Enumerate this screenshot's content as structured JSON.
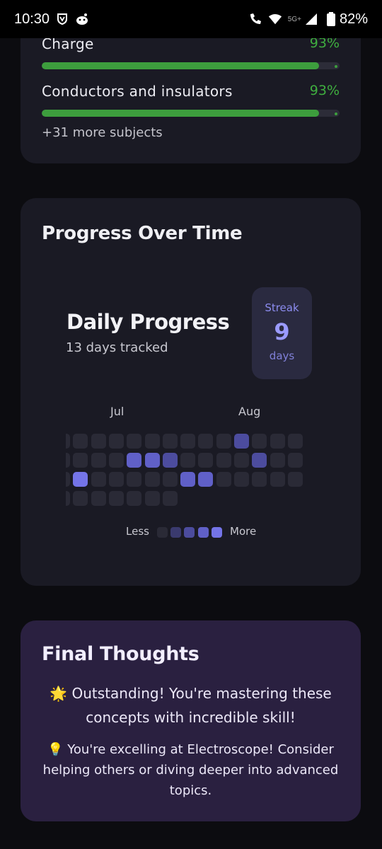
{
  "status_bar": {
    "time": "10:30",
    "network": "5G+",
    "battery": "82%"
  },
  "subjects": {
    "items": [
      {
        "name": "Charge",
        "percent_label": "93%",
        "progress": 0.93
      },
      {
        "name": "Conductors and insulators",
        "percent_label": "93%",
        "progress": 0.93
      }
    ],
    "more_label": "+31 more subjects",
    "bar_color": "#3d9e3d",
    "percent_color": "#3fae3f"
  },
  "progress": {
    "title": "Progress Over Time",
    "daily_title": "Daily Progress",
    "days_tracked": "13 days tracked",
    "streak": {
      "label": "Streak",
      "value": "9",
      "unit": "days"
    },
    "months": [
      "Jul",
      "Aug"
    ],
    "legend": {
      "less": "Less",
      "more": "More"
    },
    "level_colors": [
      "#2a2a36",
      "#3a3a6e",
      "#4c4c9e",
      "#6060c8",
      "#7474e8"
    ],
    "heatmap": {
      "week_columns": 14,
      "levels": [
        [
          0,
          0,
          0,
          0
        ],
        [
          0,
          0,
          4,
          0
        ],
        [
          0,
          0,
          0,
          0
        ],
        [
          0,
          0,
          0,
          0
        ],
        [
          0,
          3,
          0,
          0
        ],
        [
          0,
          3,
          0,
          0
        ],
        [
          0,
          2,
          0,
          0
        ],
        [
          0,
          0,
          3
        ],
        [
          0,
          0,
          3
        ],
        [
          0,
          0,
          0
        ],
        [
          2,
          0,
          0
        ],
        [
          0,
          2,
          0
        ],
        [
          0,
          0,
          0
        ],
        [
          0,
          0,
          0
        ]
      ]
    }
  },
  "final": {
    "title": "Final Thoughts",
    "message_1": "🌟 Outstanding! You're mastering these concepts with incredible skill!",
    "message_2": "💡 You're excelling at Electroscope! Consider helping others or diving deeper into advanced topics."
  }
}
